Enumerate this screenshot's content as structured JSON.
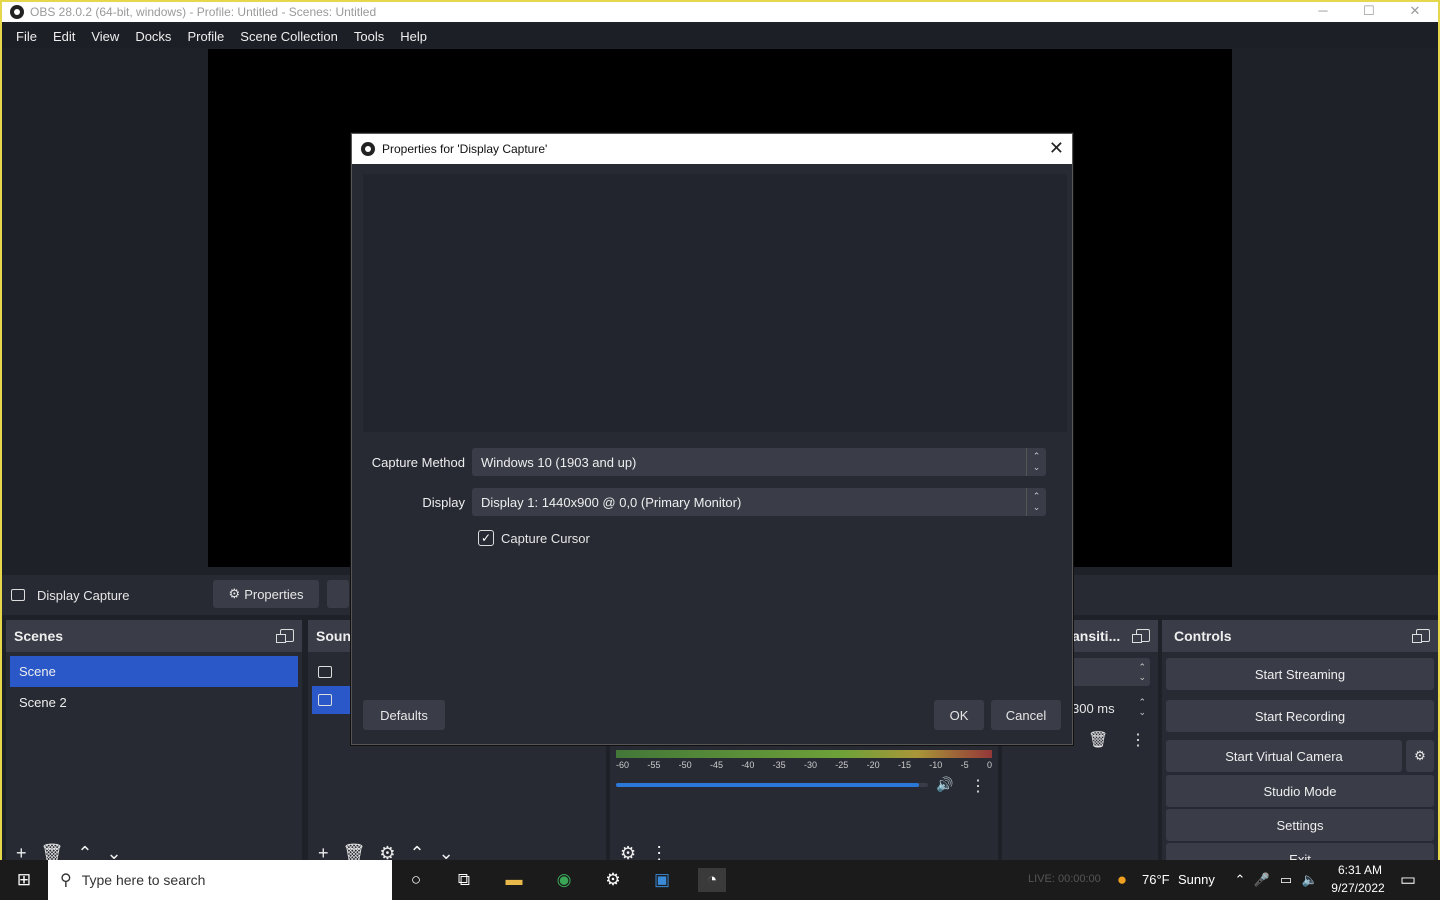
{
  "window": {
    "title": "OBS 28.0.2 (64-bit, windows) - Profile: Untitled - Scenes: Untitled",
    "controls": [
      "─",
      "☐",
      "✕"
    ]
  },
  "menu": [
    "File",
    "Edit",
    "View",
    "Docks",
    "Profile",
    "Scene Collection",
    "Tools",
    "Help"
  ],
  "source_bar": {
    "source_name": "Display Capture",
    "properties_label": "Properties"
  },
  "scenes": {
    "title": "Scenes",
    "items": [
      "Scene",
      "Scene 2"
    ],
    "selected": "Scene"
  },
  "sources": {
    "title": "Soun"
  },
  "transitions": {
    "title": "ansiti...",
    "duration": "300 ms"
  },
  "controls": {
    "title": "Controls",
    "start_streaming": "Start Streaming",
    "start_recording": "Start Recording",
    "start_virtual_camera": "Start Virtual Camera",
    "studio_mode": "Studio Mode",
    "settings": "Settings",
    "exit": "Exit"
  },
  "mixer": {
    "ticks": [
      "-60",
      "-55",
      "-50",
      "-45",
      "-40",
      "-35",
      "-30",
      "-25",
      "-20",
      "-15",
      "-10",
      "-5",
      "0"
    ],
    "volume_level": 0.97
  },
  "dialog": {
    "title": "Properties for 'Display Capture'",
    "capture_method_label": "Capture Method",
    "capture_method_value": "Windows 10 (1903 and up)",
    "display_label": "Display",
    "display_value": "Display 1: 1440x900 @ 0,0 (Primary Monitor)",
    "capture_cursor_label": "Capture Cursor",
    "capture_cursor_checked": true,
    "defaults_label": "Defaults",
    "ok_label": "OK",
    "cancel_label": "Cancel"
  },
  "taskbar": {
    "search_placeholder": "Type here to search",
    "weather_temp": "76°F",
    "weather_desc": "Sunny",
    "time": "6:31 AM",
    "date": "9/27/2022",
    "status_text": "LIVE: 00:00:00"
  }
}
